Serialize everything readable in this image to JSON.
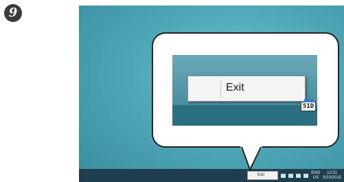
{
  "step": {
    "number": "9"
  },
  "menu": {
    "exit_label": "Exit"
  },
  "taskbar": {
    "language": "ENG",
    "region": "US",
    "time": "12:51",
    "date": "5/10/2015"
  },
  "tray_app": {
    "icon_text": "51D",
    "icon_name": "app-tray-icon"
  },
  "colors": {
    "desktop": "#4fa8b6",
    "taskbar": "#1f3f4f",
    "callout_border": "#222222"
  }
}
